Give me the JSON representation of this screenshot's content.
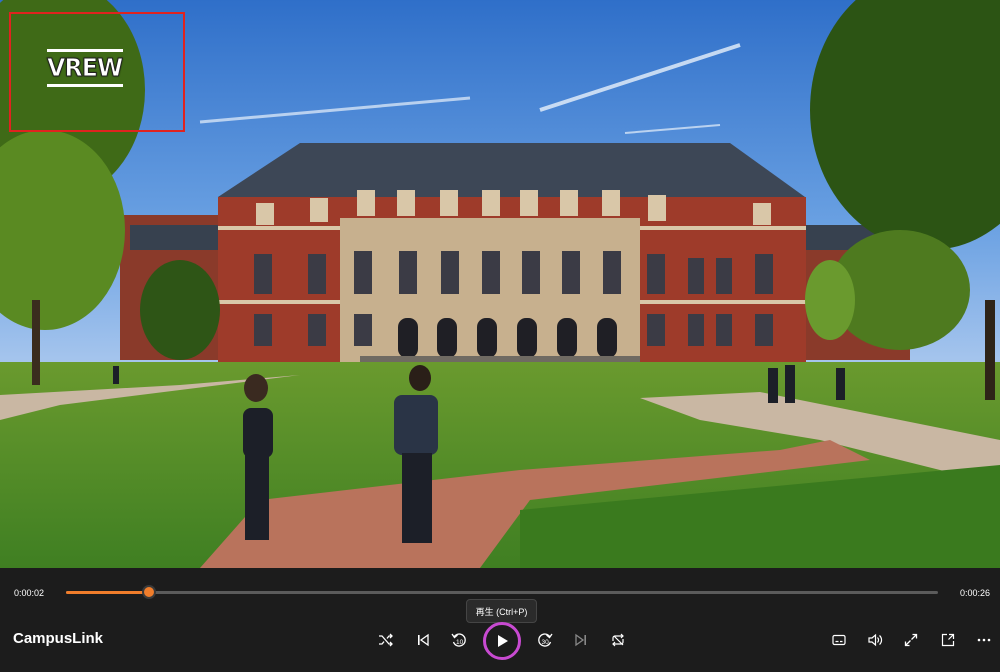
{
  "player": {
    "title": "CampusLink",
    "current_time": "0:00:02",
    "total_time": "0:00:26",
    "progress_fraction": 0.095,
    "play_tooltip": "再生 (Ctrl+P)",
    "watermark_text": "VREW",
    "accent_color": "#f07d2b",
    "play_ring_color": "#c84ad1",
    "controls": [
      {
        "name": "shuffle-icon"
      },
      {
        "name": "previous-icon"
      },
      {
        "name": "rewind-10-icon",
        "label": "10"
      },
      {
        "name": "play-icon"
      },
      {
        "name": "forward-30-icon",
        "label": "30"
      },
      {
        "name": "next-icon"
      },
      {
        "name": "repeat-icon"
      },
      {
        "name": "subtitles-icon"
      },
      {
        "name": "volume-icon"
      },
      {
        "name": "fullscreen-icon"
      },
      {
        "name": "mini-player-icon"
      },
      {
        "name": "more-icon"
      }
    ]
  }
}
